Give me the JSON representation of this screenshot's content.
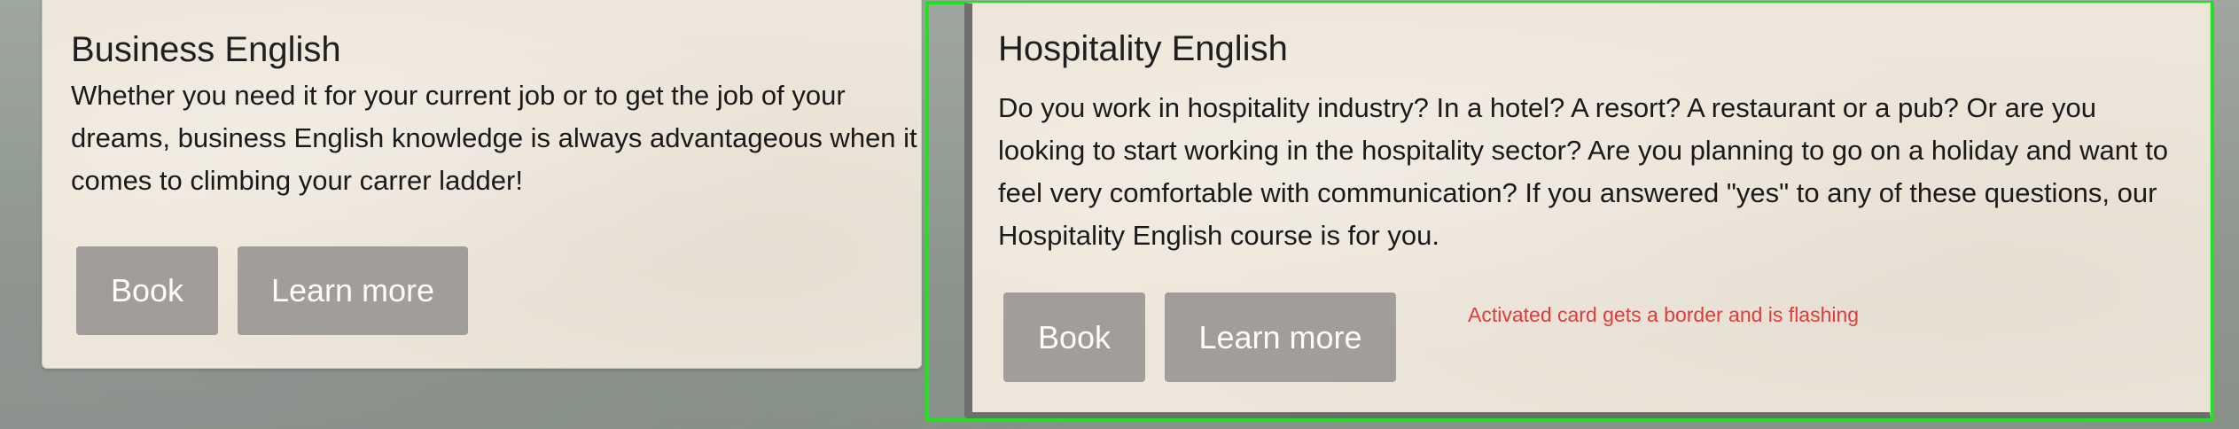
{
  "cards": [
    {
      "title": "Business English",
      "description": "Whether you need it for your current job or to get the job of your dreams, business English knowledge is always advantageous when it comes to climbing your carrer ladder!",
      "book_label": "Book",
      "learn_more_label": "Learn more"
    },
    {
      "title": "Hospitality English",
      "description": "Do you work in hospitality industry? In a hotel? A resort? A restaurant or a pub? Or are you looking to start working in the hospitality sector? Are you planning to go on a holiday and want to feel very comfortable with communication? If you answered \"yes\" to any of these questions, our Hospitality English course is for you.",
      "book_label": "Book",
      "learn_more_label": "Learn more",
      "active": true
    }
  ],
  "annotation": "Activated card gets a border and is flashing",
  "colors": {
    "active_border": "#22e022",
    "annotation_text": "#e23b3b",
    "button_bg": "#a19d9b",
    "card_bg": "#ede6da"
  }
}
